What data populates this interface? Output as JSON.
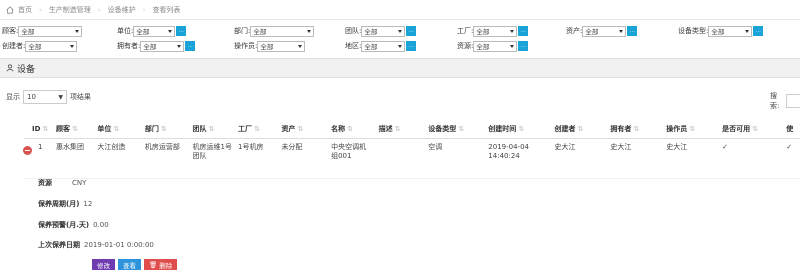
{
  "breadcrumb": [
    "首页",
    "生产制造管理",
    "设备维护",
    "查看列表"
  ],
  "filters": [
    {
      "label": "顾客:",
      "value": "全部"
    },
    {
      "label": "单位:",
      "value": "全部"
    },
    {
      "label": "部门:",
      "value": "全部"
    },
    {
      "label": "团队:",
      "value": "全部"
    },
    {
      "label": "工厂:",
      "value": "全部"
    },
    {
      "label": "资产:",
      "value": "全部"
    },
    {
      "label": "设备类型:",
      "value": "全部"
    },
    {
      "label": "创建者:",
      "value": "全部"
    },
    {
      "label": "拥有者:",
      "value": "全部"
    },
    {
      "label": "操作员:",
      "value": "全部"
    },
    {
      "label": "地区:",
      "value": "全部"
    },
    {
      "label": "资源:",
      "value": "全部"
    }
  ],
  "panel_title": "设备",
  "page_length": {
    "prefix": "显示",
    "value": "10",
    "suffix": "项结果"
  },
  "search_label": "搜索:",
  "columns": [
    "ID",
    "顾客",
    "单位",
    "部门",
    "团队",
    "工厂",
    "资产",
    "名称",
    "描述",
    "设备类型",
    "创建时间",
    "创建者",
    "拥有者",
    "操作员",
    "是否可用",
    "使"
  ],
  "row": {
    "id": "1",
    "customer": "惠水集团",
    "unit": "大江创造",
    "dept": "机房运营部",
    "team": "机房运维1号团队",
    "factory": "1号机房",
    "asset": "未分配",
    "name": "中央空调机组001",
    "desc": "",
    "type": "空调",
    "created": "2019-04-04 14:40:24",
    "creator": "史大江",
    "owner": "史大江",
    "operator": "史大江",
    "available": "✓",
    "extra": "✓"
  },
  "detail": [
    {
      "key": "资源",
      "value": "CNY"
    },
    {
      "key": "保养周期(月)",
      "value": "12"
    },
    {
      "key": "保养预警(月.天)",
      "value": "0.00"
    },
    {
      "key": "上次保养日期",
      "value": "2019-01-01 0:00:00"
    }
  ],
  "actions": {
    "edit": "修改",
    "view": "查看",
    "delete": "删除"
  }
}
